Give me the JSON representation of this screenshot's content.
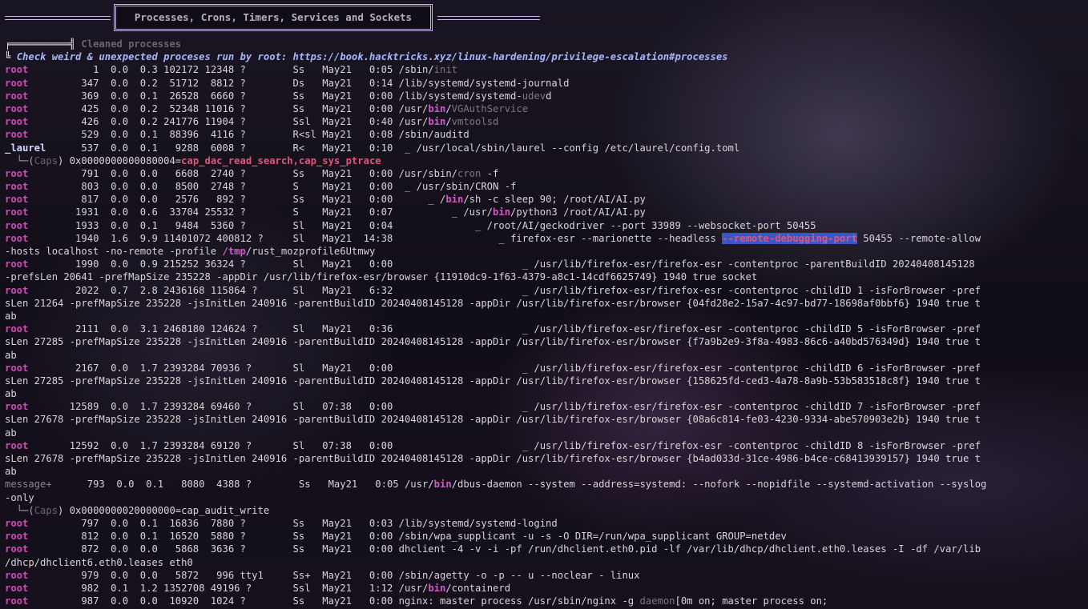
{
  "banner": {
    "title": "Processes, Crons, Timers, Services and Sockets"
  },
  "section": {
    "cleaned_label": "Cleaned processes",
    "check_note": "Check weird & unexpected proceses run by root: https://book.hacktricks.xyz/linux-hardening/privilege-escalation#processes"
  },
  "lines": [
    {
      "user": "root",
      "cols": "           1  0.0  0.3 102172 12348 ?        Ss   May21   0:05 ",
      "cmd_a": "/sbin/",
      "cmd_dim": "init",
      "cmd_b": ""
    },
    {
      "user": "root",
      "cols": "         347  0.0  0.2  51712  8812 ?        Ds   May21   0:14 ",
      "cmd_a": "/lib/systemd/systemd-journald",
      "cmd_dim": "",
      "cmd_b": ""
    },
    {
      "user": "root",
      "cols": "         369  0.0  0.1  26528  6660 ?        Ss   May21   0:00 ",
      "cmd_a": "/lib/systemd/systemd-",
      "cmd_dim": "udev",
      "cmd_b": "d"
    },
    {
      "user": "root",
      "cols": "         425  0.0  0.2  52348 11016 ?        Ss   May21   0:00 ",
      "cmd_a": "/usr/",
      "cmd_bin": "bin",
      "cmd_b2": "/",
      "cmd_dim": "VGAuthService",
      "cmd_b": ""
    },
    {
      "user": "root",
      "cols": "         426  0.0  0.2 241776 11904 ?        Ssl  May21   0:40 ",
      "cmd_a": "/usr/",
      "cmd_bin": "bin",
      "cmd_b2": "/",
      "cmd_dim": "vmtoolsd",
      "cmd_b": ""
    },
    {
      "user": "root",
      "cols": "         529  0.0  0.1  88396  4116 ?        R<sl May21   0:08 ",
      "cmd_a": "/sbin/auditd",
      "cmd_dim": "",
      "cmd_b": ""
    },
    {
      "user": "_laurel",
      "cols": "      537  0.0  0.1   9288  6008 ?        R<   May21   0:10  _ ",
      "cmd_a": "/usr/local/sbin/laurel --config /etc/laurel/config.toml",
      "cmd_dim": "",
      "cmd_b": ""
    }
  ],
  "caps_laurel": {
    "prefix": "  └─(",
    "label": "Caps",
    "mid": ") 0x0000000000080004=",
    "value": "cap_dac_read_search,cap_sys_ptrace"
  },
  "lines2": [
    {
      "user": "root",
      "text": "         791  0.0  0.0   6608  2740 ?        Ss   May21   0:00 /usr/sbin/",
      "dim": "cron",
      "rest": " -f"
    },
    {
      "user": "root",
      "text": "         803  0.0  0.0   8500  2748 ?        S    May21   0:00  _ /usr/sbin/CRON -f",
      "dim": "",
      "rest": ""
    },
    {
      "user": "root",
      "text": "         817  0.0  0.0   2576   892 ?        Ss   May21   0:00      _ ",
      "bin_pre": "/",
      "bin": "bin",
      "rest": "/sh -c sleep 90; /root/AI/AI.py"
    },
    {
      "user": "root",
      "text": "        1931  0.0  0.6  33704 25532 ?        S    May21   0:07          _ /usr/",
      "bin": "bin",
      "rest": "/python3 /root/AI/AI.py"
    },
    {
      "user": "root",
      "text": "        1933  0.0  0.1   9484  5360 ?        Sl   May21   0:04              _ /root/AI/geckodriver --port 33989 --websocket-port 50455",
      "dim": "",
      "rest": ""
    }
  ],
  "firefox_main": {
    "user": "root",
    "text": "        1940  1.6  9.9 11401072 400812 ?     Sl   May21  14:38                  _ firefox-esr --marionette --headless ",
    "highlight": "--remote-debugging-port",
    "after": " 50455 --remote-allow",
    "cont_a": "-hosts localhost -no-remote -profile ",
    "cont_tmp": "/tmp",
    "cont_b": "/rust_mozprofile6Utmwy"
  },
  "wrapped": [
    {
      "user": "root",
      "l1": "        1990  0.0  0.9 215252 36324 ?        Sl   May21   0:00                      _ /usr/lib/firefox-esr/firefox-esr -contentproc -parentBuildID 20240408145128",
      "l2": "-prefsLen 20641 -prefMapSize 235228 -appDir /usr/lib/firefox-esr/browser {11910dc9-1f63-4379-a8c1-14cdf6625749} 1940 true socket",
      "l3": ""
    },
    {
      "user": "root",
      "l1": "        2022  0.7  2.8 2436168 115864 ?      Sl   May21   6:32                      _ /usr/lib/firefox-esr/firefox-esr -contentproc -childID 1 -isForBrowser -pref",
      "l2": "sLen 21264 -prefMapSize 235228 -jsInitLen 240916 -parentBuildID 20240408145128 -appDir /usr/lib/firefox-esr/browser {04fd28e2-15a7-4c97-bd77-18698af0bbf6} 1940 true t",
      "l3": "ab"
    },
    {
      "user": "root",
      "l1": "        2111  0.0  3.1 2468180 124624 ?      Sl   May21   0:36                      _ /usr/lib/firefox-esr/firefox-esr -contentproc -childID 5 -isForBrowser -pref",
      "l2": "sLen 27285 -prefMapSize 235228 -jsInitLen 240916 -parentBuildID 20240408145128 -appDir /usr/lib/firefox-esr/browser {f7a9b2e9-3f8a-4983-86c6-a40bd576349d} 1940 true t",
      "l3": "ab"
    },
    {
      "user": "root",
      "l1": "        2167  0.0  1.7 2393284 70936 ?       Sl   May21   0:00                      _ /usr/lib/firefox-esr/firefox-esr -contentproc -childID 6 -isForBrowser -pref",
      "l2": "sLen 27285 -prefMapSize 235228 -jsInitLen 240916 -parentBuildID 20240408145128 -appDir /usr/lib/firefox-esr/browser {158625fd-ced3-4a78-8a9b-53b583518c8f} 1940 true t",
      "l3": "ab"
    },
    {
      "user": "root",
      "l1": "       12589  0.0  1.7 2393284 69460 ?       Sl   07:38   0:00                      _ /usr/lib/firefox-esr/firefox-esr -contentproc -childID 7 -isForBrowser -pref",
      "l2": "sLen 27678 -prefMapSize 235228 -jsInitLen 240916 -parentBuildID 20240408145128 -appDir /usr/lib/firefox-esr/browser {08a6c814-fe03-4230-9334-abe570903e2b} 1940 true t",
      "l3": "ab"
    },
    {
      "user": "root",
      "l1": "       12592  0.0  1.7 2393284 69120 ?       Sl   07:38   0:00                      _ /usr/lib/firefox-esr/firefox-esr -contentproc -childID 8 -isForBrowser -pref",
      "l2": "sLen 27678 -prefMapSize 235228 -jsInitLen 240916 -parentBuildID 20240408145128 -appDir /usr/lib/firefox-esr/browser {b4ad033d-31ce-4986-b4ce-c68413939157} 1940 true t",
      "l3": "ab"
    }
  ],
  "dbus": {
    "user": "message+",
    "a": "      793  0.0  0.1   8080  4388 ?        Ss   May21   0:05 /usr/",
    "bin": "bin",
    "b": "/dbus-daemon --system --address=systemd: --nofork --nopidfile --systemd-activation --syslog",
    "l2": "-only",
    "caps_prefix": "  └─(",
    "caps_label": "Caps",
    "caps_rest": ") 0x0000000020000000=cap_audit_write"
  },
  "tail": [
    {
      "user": "root",
      "text": "         797  0.0  0.1  16836  7880 ?        Ss   May21   0:03 /lib/systemd/systemd-logind"
    },
    {
      "user": "root",
      "text": "         812  0.0  0.1  16520  5880 ?        Ss   May21   0:00 /sbin/wpa_supplicant -u -s -O DIR=/run/wpa_supplicant GROUP=netdev"
    },
    {
      "user": "root",
      "text": "         872  0.0  0.0   5868  3636 ?        Ss   May21   0:00 dhclient -4 -v -i -pf /run/dhclient.eth0.pid -lf /var/lib/dhcp/dhclient.eth0.leases -I -df /var/lib"
    },
    {
      "user": "",
      "text": "/dhcp/dhclient6.eth0.leases eth0"
    },
    {
      "user": "root",
      "text": "         979  0.0  0.0   5872   996 tty1     Ss+  May21   0:00 /sbin/agetty -o -p -- u --noclear - linux"
    }
  ],
  "containerd": {
    "user": "root",
    "a": "         982  0.1  1.2 1352708 49196 ?       Ssl  May21   1:12 /usr/",
    "bin": "bin",
    "b": "/containerd"
  },
  "nginx": {
    "user": "root",
    "a": "         987  0.0  0.0  10920  1024 ?        Ss   May21   0:00 nginx: master process /usr/sbin/nginx -g ",
    "dim": "daemon",
    "b": "[0m on; master process on;"
  }
}
